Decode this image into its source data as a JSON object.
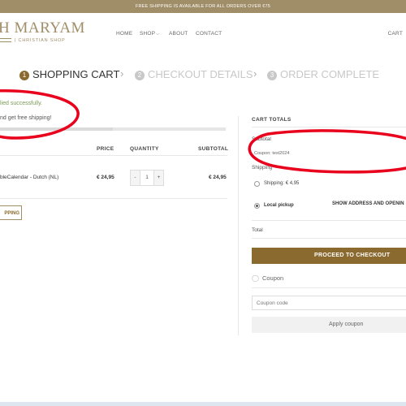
{
  "topbar": {
    "text": "FREE SHIPPING IS AVAILABLE FOR ALL ORDERS OVER €75"
  },
  "header": {
    "logo": "H MARYAM",
    "logo_sub": "| CHRISTIAN SHOP",
    "nav": {
      "home": "HOME",
      "shop": "SHOP",
      "about": "ABOUT",
      "contact": "CONTACT",
      "cart": "CART"
    }
  },
  "steps": [
    {
      "num": "1",
      "label": "SHOPPING CART"
    },
    {
      "num": "2",
      "label": "CHECKOUT DETAILS"
    },
    {
      "num": "3",
      "label": "ORDER COMPLETE"
    }
  ],
  "notices": {
    "applied": "lied successfully.",
    "free_shipping": "nd get free shipping!"
  },
  "free_shipping_progress": 0.5,
  "cart_table": {
    "headers": {
      "price": "PRICE",
      "quantity": "QUANTITY",
      "subtotal": "SUBTOTAL"
    },
    "row": {
      "product": "bleCalendar - Dutch (NL)",
      "price": "€ 24,95",
      "qty": "1",
      "subtotal": "€ 24,95"
    },
    "continue_label": "PPING"
  },
  "totals": {
    "title": "CART TOTALS",
    "subtotal_label": "Subtotal",
    "coupon_tag": "Coupon: test2024",
    "shipping_label": "Shipping",
    "shipping_option": "Shipping:",
    "shipping_price": "€ 4,95",
    "local_pickup": "Local pickup",
    "show_address": "SHOW ADDRESS AND OPENIN",
    "total_label": "Total",
    "checkout_btn": "PROCEED TO CHECKOUT",
    "coupon_heading": "Coupon",
    "coupon_placeholder": "Coupon code",
    "apply_btn": "Apply coupon"
  },
  "icons": {
    "tag": "tag-icon",
    "chevron": "chevron-right-icon"
  },
  "colors": {
    "brand": "#a08e68",
    "button": "#8a6a2e",
    "annotation": "#e8001c"
  }
}
